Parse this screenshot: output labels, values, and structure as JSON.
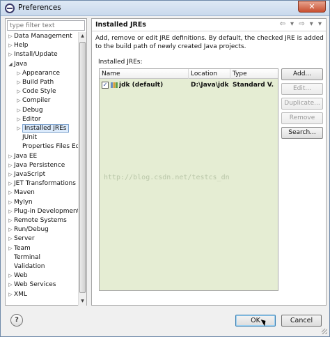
{
  "window": {
    "title": "Preferences",
    "close_label": "✕"
  },
  "filter": {
    "placeholder": "type filter text"
  },
  "tree": [
    {
      "label": "Data Management",
      "arrow": "▷",
      "indent": 0
    },
    {
      "label": "Help",
      "arrow": "▷",
      "indent": 0
    },
    {
      "label": "Install/Update",
      "arrow": "▷",
      "indent": 0
    },
    {
      "label": "Java",
      "arrow": "◢",
      "indent": 0
    },
    {
      "label": "Appearance",
      "arrow": "▷",
      "indent": 1
    },
    {
      "label": "Build Path",
      "arrow": "▷",
      "indent": 1
    },
    {
      "label": "Code Style",
      "arrow": "▷",
      "indent": 1
    },
    {
      "label": "Compiler",
      "arrow": "▷",
      "indent": 1
    },
    {
      "label": "Debug",
      "arrow": "▷",
      "indent": 1
    },
    {
      "label": "Editor",
      "arrow": "▷",
      "indent": 1
    },
    {
      "label": "Installed JREs",
      "arrow": "▷",
      "indent": 1,
      "selected": true
    },
    {
      "label": "JUnit",
      "arrow": "",
      "indent": 1
    },
    {
      "label": "Properties Files Ed",
      "arrow": "",
      "indent": 1
    },
    {
      "label": "Java EE",
      "arrow": "▷",
      "indent": 0
    },
    {
      "label": "Java Persistence",
      "arrow": "▷",
      "indent": 0
    },
    {
      "label": "JavaScript",
      "arrow": "▷",
      "indent": 0
    },
    {
      "label": "JET Transformations",
      "arrow": "▷",
      "indent": 0
    },
    {
      "label": "Maven",
      "arrow": "▷",
      "indent": 0
    },
    {
      "label": "Mylyn",
      "arrow": "▷",
      "indent": 0
    },
    {
      "label": "Plug-in Development",
      "arrow": "▷",
      "indent": 0
    },
    {
      "label": "Remote Systems",
      "arrow": "▷",
      "indent": 0
    },
    {
      "label": "Run/Debug",
      "arrow": "▷",
      "indent": 0
    },
    {
      "label": "Server",
      "arrow": "▷",
      "indent": 0
    },
    {
      "label": "Team",
      "arrow": "▷",
      "indent": 0
    },
    {
      "label": "Terminal",
      "arrow": "",
      "indent": 0
    },
    {
      "label": "Validation",
      "arrow": "",
      "indent": 0
    },
    {
      "label": "Web",
      "arrow": "▷",
      "indent": 0
    },
    {
      "label": "Web Services",
      "arrow": "▷",
      "indent": 0
    },
    {
      "label": "XML",
      "arrow": "▷",
      "indent": 0
    }
  ],
  "page": {
    "title": "Installed JREs",
    "nav": "⇦ ▾ ⇨ ▾ ▾",
    "description": "Add, remove or edit JRE definitions. By default, the checked JRE is added to the build path of newly created Java projects.",
    "installed_label": "Installed JREs:"
  },
  "table": {
    "headers": {
      "name": "Name",
      "location": "Location",
      "type": "Type"
    },
    "rows": [
      {
        "checked": "✓",
        "name": "jdk (default)",
        "location": "D:\\Java\\jdk",
        "type": "Standard V..."
      }
    ],
    "watermark": "http://blog.csdn.net/testcs_dn"
  },
  "buttons": {
    "add": "Add...",
    "edit": "Edit...",
    "duplicate": "Duplicate...",
    "remove": "Remove",
    "search": "Search...",
    "help": "?",
    "ok": "OK",
    "cancel": "Cancel"
  },
  "colors": {
    "table_background": "#e5edd3",
    "selection": "#dcebfc",
    "titlebar": "#c9d9ec"
  }
}
